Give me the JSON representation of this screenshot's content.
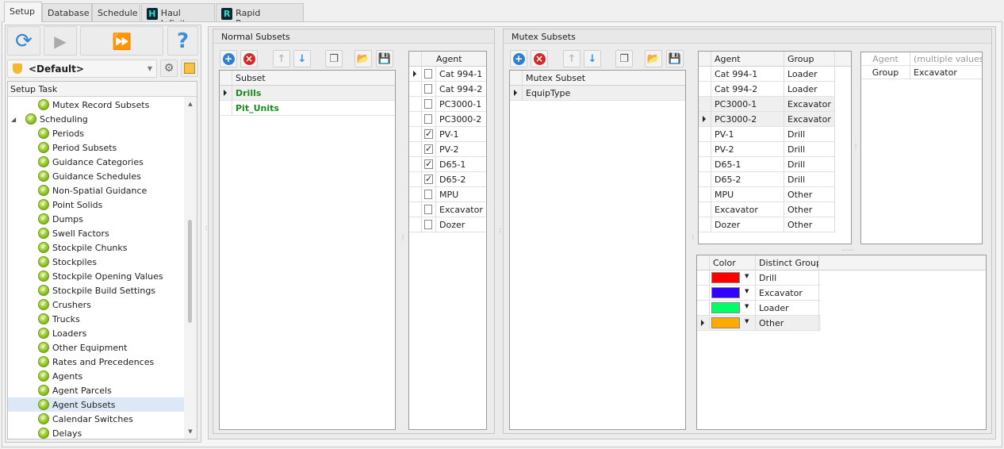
{
  "tabs": [
    {
      "label": "Setup"
    },
    {
      "label": "Database"
    },
    {
      "label": "Schedule"
    },
    {
      "label": "Haul Infinity",
      "logo": "H"
    },
    {
      "label": "Rapid Reserver",
      "logo": "R"
    }
  ],
  "left": {
    "profile": "<Default>",
    "tree_header": "Setup Task",
    "tree": [
      {
        "label": "Mutex Record Subsets",
        "level": 2
      },
      {
        "label": "Scheduling",
        "level": 1,
        "expanded": true
      },
      {
        "label": "Periods",
        "level": 2
      },
      {
        "label": "Period Subsets",
        "level": 2
      },
      {
        "label": "Guidance Categories",
        "level": 2
      },
      {
        "label": "Guidance Schedules",
        "level": 2
      },
      {
        "label": "Non-Spatial Guidance",
        "level": 2
      },
      {
        "label": "Point Solids",
        "level": 2
      },
      {
        "label": "Dumps",
        "level": 2
      },
      {
        "label": "Swell Factors",
        "level": 2
      },
      {
        "label": "Stockpile Chunks",
        "level": 2
      },
      {
        "label": "Stockpiles",
        "level": 2
      },
      {
        "label": "Stockpile Opening Values",
        "level": 2
      },
      {
        "label": "Stockpile Build Settings",
        "level": 2
      },
      {
        "label": "Crushers",
        "level": 2
      },
      {
        "label": "Trucks",
        "level": 2
      },
      {
        "label": "Loaders",
        "level": 2
      },
      {
        "label": "Other Equipment",
        "level": 2
      },
      {
        "label": "Rates and Precedences",
        "level": 2
      },
      {
        "label": "Agents",
        "level": 2
      },
      {
        "label": "Agent Parcels",
        "level": 2
      },
      {
        "label": "Agent Subsets",
        "level": 2,
        "selected": true
      },
      {
        "label": "Calendar Switches",
        "level": 2
      },
      {
        "label": "Delays",
        "level": 2
      }
    ]
  },
  "normal": {
    "title": "Normal Subsets",
    "subset_header": "Subset",
    "subsets": [
      {
        "name": "Drills",
        "selected": true
      },
      {
        "name": "Pit_Units"
      }
    ],
    "agent_header": "Agent",
    "agents": [
      {
        "name": "Cat 994-1",
        "checked": false,
        "current": true
      },
      {
        "name": "Cat 994-2",
        "checked": false
      },
      {
        "name": "PC3000-1",
        "checked": false
      },
      {
        "name": "PC3000-2",
        "checked": false
      },
      {
        "name": "PV-1",
        "checked": true
      },
      {
        "name": "PV-2",
        "checked": true
      },
      {
        "name": "D65-1",
        "checked": true
      },
      {
        "name": "D65-2",
        "checked": true
      },
      {
        "name": "MPU",
        "checked": false
      },
      {
        "name": "Excavator",
        "checked": false
      },
      {
        "name": "Dozer",
        "checked": false
      }
    ]
  },
  "mutex": {
    "title": "Mutex Subsets",
    "subset_header": "Mutex Subset",
    "subsets": [
      {
        "name": "EquipType",
        "selected": true
      }
    ],
    "agent_header": "Agent",
    "group_header": "Group",
    "rows": [
      {
        "agent": "Cat 994-1",
        "group": "Loader"
      },
      {
        "agent": "Cat 994-2",
        "group": "Loader"
      },
      {
        "agent": "PC3000-1",
        "group": "Excavator",
        "hl": true
      },
      {
        "agent": "PC3000-2",
        "group": "Excavator",
        "hl": true,
        "current": true
      },
      {
        "agent": "PV-1",
        "group": "Drill"
      },
      {
        "agent": "PV-2",
        "group": "Drill"
      },
      {
        "agent": "D65-1",
        "group": "Drill"
      },
      {
        "agent": "D65-2",
        "group": "Drill"
      },
      {
        "agent": "MPU",
        "group": "Other"
      },
      {
        "agent": "Excavator",
        "group": "Other"
      },
      {
        "agent": "Dozer",
        "group": "Other"
      }
    ],
    "props": [
      {
        "key": "Agent",
        "value": "(multiple values)",
        "dim": true
      },
      {
        "key": "Group",
        "value": "Excavator"
      }
    ],
    "color_header": "Color",
    "distinct_header": "Distinct Group",
    "groups": [
      {
        "color": "#ff0000",
        "name": "Drill"
      },
      {
        "color": "#3300ff",
        "name": "Excavator"
      },
      {
        "color": "#00ff66",
        "name": "Loader"
      },
      {
        "color": "#ffaa00",
        "name": "Other",
        "current": true
      }
    ]
  }
}
